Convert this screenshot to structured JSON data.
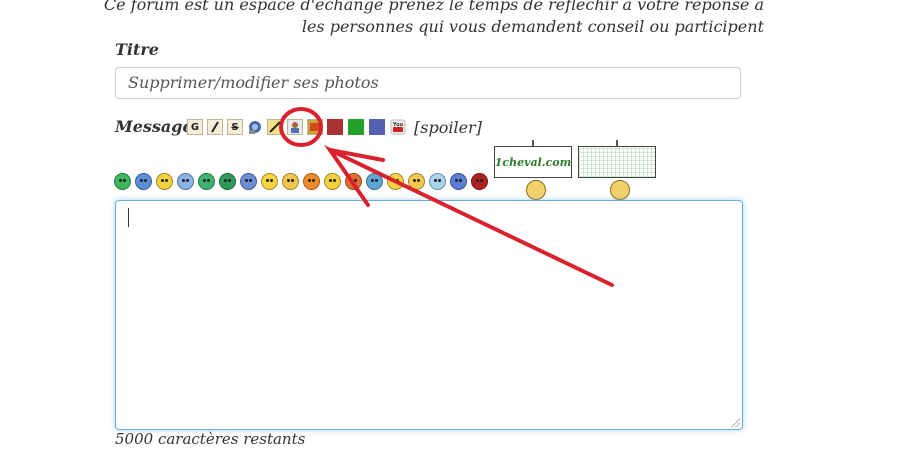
{
  "notice": {
    "line1": "Ce forum est un espace d'échange prenez le temps de réfléchir à votre réponse à",
    "line2": "les personnes qui vous demandent conseil ou participent"
  },
  "title_field": {
    "label": "Titre",
    "value": "Supprimer/modifier ses photos"
  },
  "message_field": {
    "label": "Message",
    "value": "",
    "remaining": "5000 caractères restants"
  },
  "toolbar": {
    "bold": "G",
    "italic": "I",
    "strike": "S",
    "spoiler": "[spoiler]",
    "icons": [
      "bold-icon",
      "italic-icon",
      "strike-icon",
      "link-icon",
      "image-icon",
      "photo-icon",
      "video-icon",
      "youtube-icon"
    ],
    "colors": [
      "#a83232",
      "#22a02a",
      "#5560b0"
    ]
  },
  "smileys": {
    "colors": [
      "#3fb85c",
      "#5b8fd9",
      "#f4d23e",
      "#8ab4e6",
      "#3cb371",
      "#2e9b5a",
      "#6a8fd6",
      "#f6d440",
      "#f2c94c",
      "#f08c2a",
      "#f4d23e",
      "#e07030",
      "#5ba8d8",
      "#f6d440",
      "#f2c94c",
      "#a8d8f0",
      "#5b7fd6",
      "#b02020"
    ],
    "sign_text": "1cheval.com"
  },
  "annotation": {
    "color": "#d9222e"
  }
}
